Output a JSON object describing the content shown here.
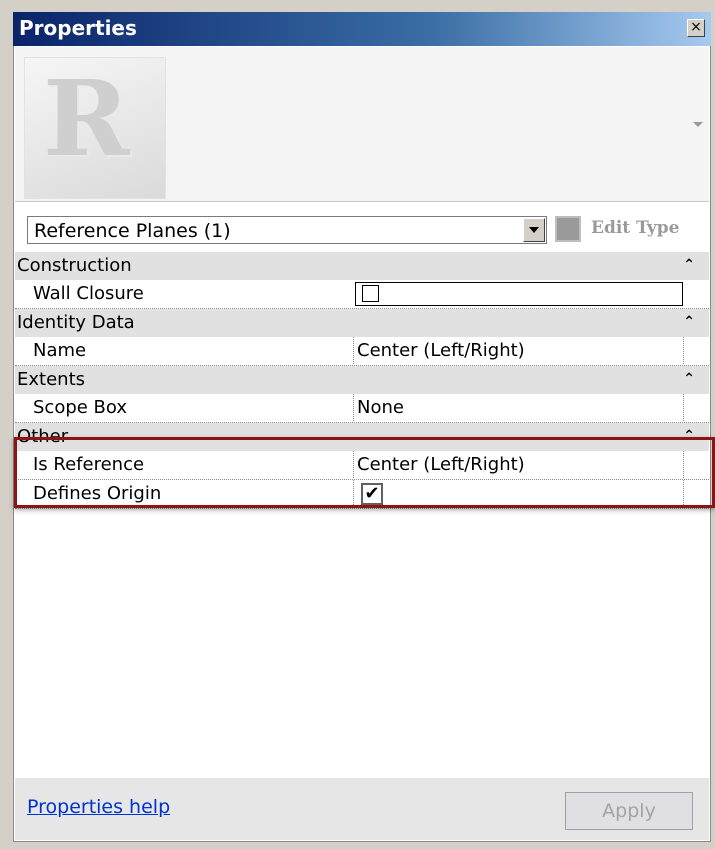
{
  "window": {
    "title": "Properties",
    "close_label": "×"
  },
  "preview": {
    "logo_letter": "R"
  },
  "type_selector": {
    "value": "Reference Planes (1)",
    "edit_type_label": "Edit Type"
  },
  "groups": [
    {
      "label": "Construction",
      "collapse": "⌃",
      "properties": [
        {
          "label": "Wall Closure",
          "value": "",
          "checked": false
        }
      ]
    },
    {
      "label": "Identity Data",
      "collapse": "⌃",
      "properties": [
        {
          "label": "Name",
          "value": "Center (Left/Right)"
        }
      ]
    },
    {
      "label": "Extents",
      "collapse": "⌃",
      "properties": [
        {
          "label": "Scope Box",
          "value": "None"
        }
      ]
    },
    {
      "label": "Other",
      "collapse": "⌃",
      "properties": [
        {
          "label": "Is Reference",
          "value": "Center (Left/Right)"
        },
        {
          "label": "Defines Origin",
          "value": "",
          "checked": true,
          "check_mark": "✔"
        }
      ]
    }
  ],
  "footer": {
    "help_link": "Properties help",
    "apply_label": "Apply"
  },
  "colors": {
    "highlight_border": "#8b1515",
    "link": "#0033cc",
    "titlebar": "#0a246a"
  }
}
